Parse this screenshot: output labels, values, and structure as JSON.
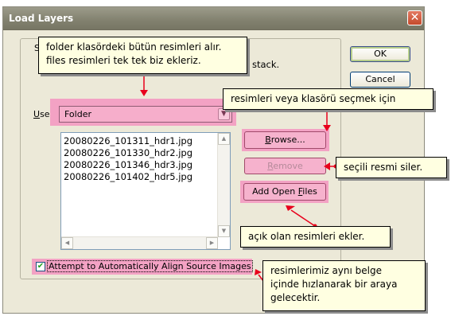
{
  "window": {
    "title": "Load Layers",
    "close_glyph": "✕"
  },
  "group": {
    "partial_label": "stack."
  },
  "buttons": {
    "ok": "OK",
    "cancel": "Cancel"
  },
  "use": {
    "label_underlined": "U",
    "label_rest": "se:",
    "value": "Folder"
  },
  "files": [
    "20080226_101311_hdr1.jpg",
    "20080226_101330_hdr2.jpg",
    "20080226_101346_hdr3.jpg",
    "20080226_101402_hdr5.jpg"
  ],
  "side_buttons": {
    "browse_u": "B",
    "browse_rest": "rowse...",
    "remove_u": "R",
    "remove_rest": "emove",
    "add_pre": "Add Open ",
    "add_u": "F",
    "add_rest": "iles"
  },
  "checkbox": {
    "label": "Attempt to Automatically Align Source Images",
    "checked": true
  },
  "tooltips": {
    "folder_line1": "folder klasördeki bütün resimleri alır.",
    "folder_line2": "files resimleri tek tek biz ekleriz.",
    "browse": "resimleri veya klasörü seçmek için",
    "remove": "seçili resmi siler.",
    "add_open": "açık olan resimleri ekler.",
    "align_line1": "resimlerimiz aynı belge",
    "align_line2": "içinde hızlanarak bir araya",
    "align_line3": "gelecektir."
  },
  "colors": {
    "highlight": "#f3a2c4",
    "tooltip_bg": "#ffffe1",
    "arrow": "#e8001c"
  }
}
